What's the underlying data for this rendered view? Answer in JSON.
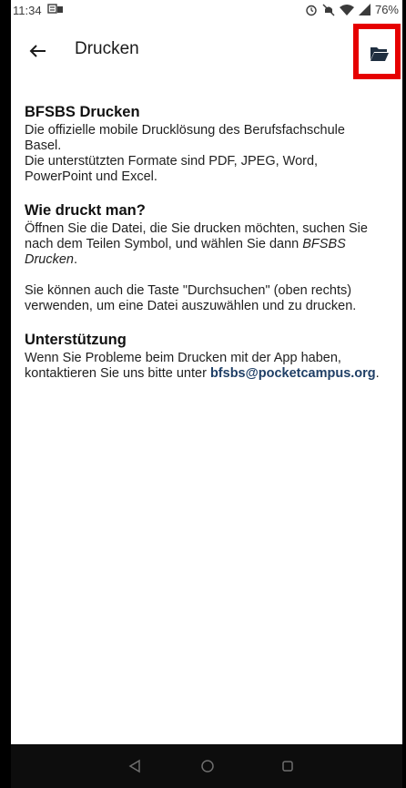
{
  "status_bar": {
    "time": "11:34",
    "battery": "76%"
  },
  "app_bar": {
    "title": "Drucken"
  },
  "content": {
    "intro": {
      "heading": "BFSBS Drucken",
      "line1": "Die offizielle mobile Drucklösung des Berufsfachschule Basel.",
      "line2": "Die unterstützten Formate sind PDF, JPEG, Word, PowerPoint und Excel."
    },
    "how_to": {
      "heading": "Wie druckt man?",
      "para1_text": "Öffnen Sie die Datei, die Sie drucken möchten, suchen Sie nach dem Teilen Symbol, und wählen Sie dann",
      "para1_app": "BFSBS Drucken",
      "para1_end": ".",
      "para2": "Sie können auch die Taste \"Durchsuchen\" (oben rechts) verwenden, um eine Datei auszuwählen und zu drucken."
    },
    "support": {
      "heading": "Unterstützung",
      "text": "Wenn Sie Probleme beim Drucken mit der App haben, kontaktieren Sie uns bitte unter",
      "email": "bfsbs@pocketcampus.org",
      "end": "."
    }
  },
  "colors": {
    "highlight": "#e60000",
    "nav_bar": "#0d0d0d",
    "email": "#1f3f66"
  },
  "icons": {
    "back": "arrow-left-icon",
    "browse": "folder-open-icon",
    "nav_back": "triangle-back-icon",
    "nav_home": "circle-home-icon",
    "nav_recents": "square-recents-icon"
  }
}
